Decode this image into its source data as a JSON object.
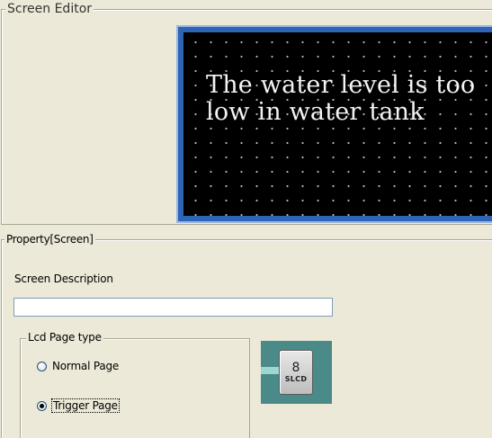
{
  "screen_editor": {
    "legend": "Screen Editor",
    "lcd_text": "The water level is too low in water tank"
  },
  "property": {
    "legend": "Property[Screen]",
    "screen_description": {
      "label": "Screen Description",
      "value": ""
    },
    "lcd_page_type": {
      "legend": "Lcd Page type",
      "options": [
        {
          "label": "Normal  Page",
          "checked": false
        },
        {
          "label": "Trigger Page",
          "checked": true
        }
      ]
    },
    "device_icon": {
      "number": "8",
      "label": "SLCD"
    }
  },
  "colors": {
    "window_bg": "#ece9d8",
    "lcd_bezel": "#2f63b5",
    "lcd_screen": "#000000",
    "lcd_text": "#f4f4f4",
    "device_tile": "#4a8a88"
  }
}
